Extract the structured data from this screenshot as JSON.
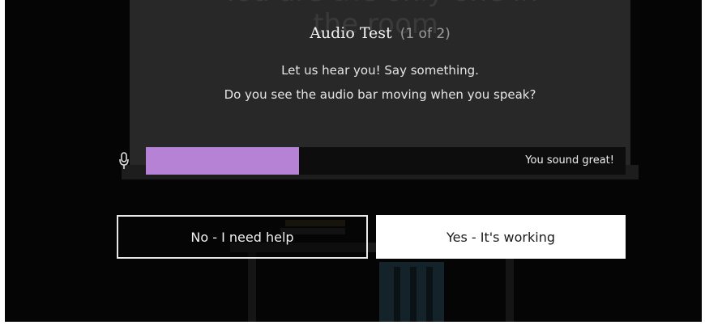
{
  "background": {
    "heading_line1": "You are the only one in",
    "heading_line2": "the room."
  },
  "dialog": {
    "title": "Audio Test",
    "step": "(1 of 2)",
    "instruction_line1": "Let us hear you! Say something.",
    "instruction_line2": "Do you see the audio bar moving when you speak?"
  },
  "meter": {
    "icon": "microphone-icon",
    "level_fraction": 0.32,
    "status_text": "You sound great!",
    "fill_color": "#b582d6"
  },
  "buttons": {
    "no_label": "No - I need help",
    "yes_label": "Yes - It's working"
  },
  "colors": {
    "background": "#050505",
    "panel": "#282828",
    "accent": "#b582d6"
  }
}
